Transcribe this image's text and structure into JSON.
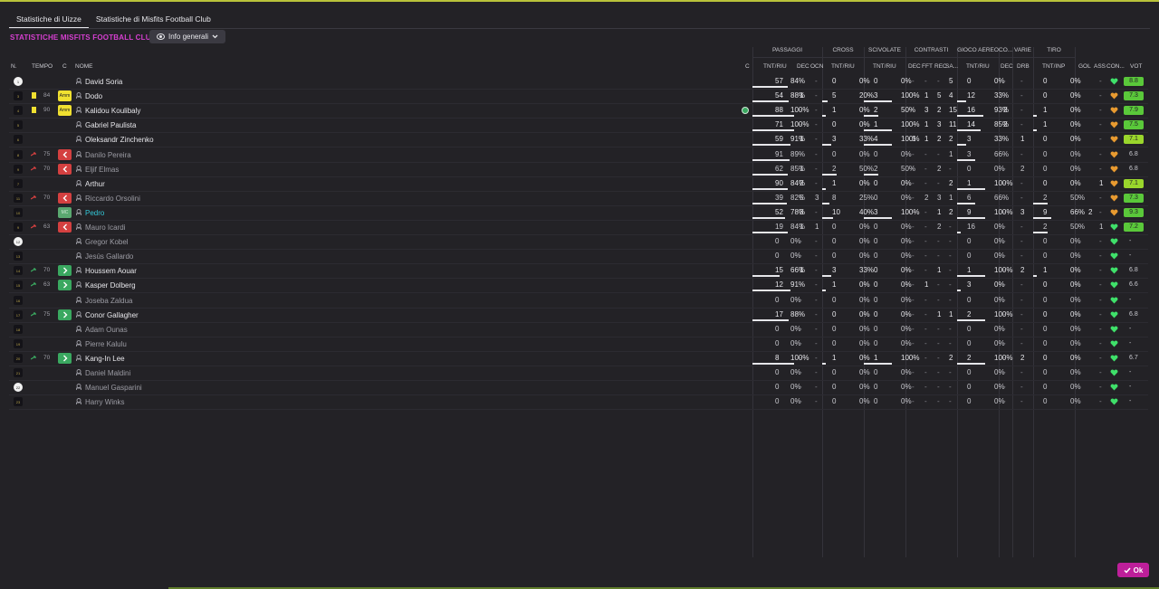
{
  "tabs": [
    "Statistiche di Uizze",
    "Statistiche di Misfits Football Club"
  ],
  "section_title": "STATISTICHE MISFITS FOOTBALL CLUB",
  "dropdown_label": "Info generali",
  "groups": [
    "PASSAGGI",
    "CROSS",
    "SCIVOLATE",
    "CONTRASTI",
    "GIOCO AEREO",
    "CO...",
    "VARIE",
    "TIRO"
  ],
  "col_left": [
    "N.",
    "TEMPO",
    "C",
    "NOME",
    "C"
  ],
  "col_stats": [
    "TNT/RIU",
    "DEC",
    "OCN",
    "TNT/RIU",
    "TNT/RIU",
    "DEC",
    "FFT",
    "REC",
    "SA...",
    "TNT/RIU",
    "DEC",
    "DRB",
    "TNT/INP",
    "GOL",
    "ASS",
    "CON...",
    "VOT"
  ],
  "ok_label": "Ok",
  "colors": {
    "accent": "#d63fd0",
    "ok": "#bd1f9a",
    "vote_green": "#5ac83a",
    "vote_lime": "#9ad62c",
    "heart_green": "#3fe06a",
    "heart_orange": "#e89a30",
    "sub_out": "#d44040",
    "sub_in": "#3aa860",
    "yellow": "#f0e030",
    "cyan": "#33c8d8"
  },
  "players": [
    {
      "num": "1",
      "gk": true,
      "min": "",
      "card": "",
      "role": "",
      "name": "David Soria",
      "dim": false,
      "pt": "57",
      "pp": "84%",
      "pd": "-",
      "po": "-",
      "ct": "0",
      "cp": "0%",
      "st": "0",
      "sp": "0%",
      "kd": "-",
      "kf": "-",
      "kr": "-",
      "ks": "5",
      "at": "0",
      "ap": "0%",
      "cd": "-",
      "dr": "-",
      "tt": "0",
      "tp": "0%",
      "gol": "",
      "ass": "-",
      "con": "green",
      "vot": "8.8",
      "vc": "green"
    },
    {
      "num": "3",
      "gk": false,
      "min": "84",
      "card": "y",
      "role": "Amm",
      "name": "Dodo",
      "dim": false,
      "pt": "54",
      "pp": "88%",
      "pd": "1",
      "po": "-",
      "ct": "5",
      "cp": "20%",
      "st": "3",
      "sp": "100%",
      "kd": "-",
      "kf": "1",
      "kr": "5",
      "ks": "4",
      "at": "12",
      "ap": "33%",
      "cd": "-",
      "dr": "-",
      "tt": "0",
      "tp": "0%",
      "gol": "",
      "ass": "-",
      "con": "orange",
      "vot": "7.3",
      "vc": "green"
    },
    {
      "num": "4",
      "gk": false,
      "min": "90",
      "card": "y",
      "role": "Amm",
      "name": "Kalidou Koulibaly",
      "dim": false,
      "cbadge": true,
      "pt": "88",
      "pp": "100%",
      "pd": "-",
      "po": "-",
      "ct": "1",
      "cp": "0%",
      "st": "2",
      "sp": "50%",
      "kd": "-",
      "kf": "3",
      "kr": "2",
      "ks": "15",
      "at": "16",
      "ap": "93%",
      "cd": "2",
      "dr": "-",
      "tt": "1",
      "tp": "0%",
      "gol": "",
      "ass": "-",
      "con": "orange",
      "vot": "7.9",
      "vc": "green"
    },
    {
      "num": "5",
      "gk": false,
      "min": "",
      "card": "",
      "role": "",
      "name": "Gabriel Paulista",
      "dim": false,
      "pt": "71",
      "pp": "100%",
      "pd": "-",
      "po": "-",
      "ct": "0",
      "cp": "0%",
      "st": "1",
      "sp": "100%",
      "kd": "-",
      "kf": "1",
      "kr": "3",
      "ks": "11",
      "at": "14",
      "ap": "85%",
      "cd": "2",
      "dr": "-",
      "tt": "1",
      "tp": "0%",
      "gol": "",
      "ass": "-",
      "con": "orange",
      "vot": "7.5",
      "vc": "green"
    },
    {
      "num": "6",
      "gk": false,
      "min": "",
      "card": "",
      "role": "",
      "name": "Oleksandr Zinchenko",
      "dim": false,
      "pt": "59",
      "pp": "91%",
      "pd": "1",
      "po": "-",
      "ct": "3",
      "cp": "33%",
      "st": "4",
      "sp": "100%",
      "kd": "1",
      "kf": "1",
      "kr": "2",
      "ks": "2",
      "at": "3",
      "ap": "33%",
      "cd": "-",
      "dr": "1",
      "tt": "0",
      "tp": "0%",
      "gol": "",
      "ass": "-",
      "con": "orange",
      "vot": "7.1",
      "vc": "lime"
    },
    {
      "num": "8",
      "gk": false,
      "min": "75",
      "card": "",
      "sub": "out",
      "role": "",
      "name": "Danilo Pereira",
      "dim": true,
      "pt": "91",
      "pp": "89%",
      "pd": "-",
      "po": "-",
      "ct": "0",
      "cp": "0%",
      "st": "0",
      "sp": "0%",
      "kd": "-",
      "kf": "-",
      "kr": "-",
      "ks": "1",
      "at": "3",
      "ap": "66%",
      "cd": "-",
      "dr": "-",
      "tt": "0",
      "tp": "0%",
      "gol": "",
      "ass": "-",
      "con": "orange",
      "vot": "6.8",
      "vc": "plain"
    },
    {
      "num": "9",
      "gk": false,
      "min": "70",
      "card": "",
      "sub": "out",
      "role": "",
      "name": "Eljif Elmas",
      "dim": true,
      "pt": "62",
      "pp": "85%",
      "pd": "1",
      "po": "-",
      "ct": "2",
      "cp": "50%",
      "st": "2",
      "sp": "50%",
      "kd": "-",
      "kf": "-",
      "kr": "2",
      "ks": "-",
      "at": "0",
      "ap": "0%",
      "cd": "-",
      "dr": "2",
      "tt": "0",
      "tp": "0%",
      "gol": "",
      "ass": "-",
      "con": "orange",
      "vot": "6.8",
      "vc": "plain"
    },
    {
      "num": "7",
      "gk": false,
      "min": "",
      "card": "",
      "role": "",
      "name": "Arthur",
      "dim": false,
      "pt": "90",
      "pp": "84%",
      "pd": "2",
      "po": "-",
      "ct": "1",
      "cp": "0%",
      "st": "0",
      "sp": "0%",
      "kd": "-",
      "kf": "-",
      "kr": "-",
      "ks": "2",
      "at": "1",
      "ap": "100%",
      "cd": "-",
      "dr": "-",
      "tt": "0",
      "tp": "0%",
      "gol": "",
      "ass": "1",
      "con": "orange",
      "vot": "7.1",
      "vc": "lime"
    },
    {
      "num": "11",
      "gk": false,
      "min": "70",
      "card": "",
      "sub": "out",
      "role": "",
      "name": "Riccardo Orsolini",
      "dim": true,
      "pt": "39",
      "pp": "82%",
      "pd": "5",
      "po": "3",
      "ct": "8",
      "cp": "25%",
      "st": "0",
      "sp": "0%",
      "kd": "-",
      "kf": "2",
      "kr": "3",
      "ks": "1",
      "at": "6",
      "ap": "66%",
      "cd": "-",
      "dr": "-",
      "tt": "2",
      "tp": "50%",
      "gol": "",
      "ass": "-",
      "con": "orange",
      "vot": "7.3",
      "vc": "green"
    },
    {
      "num": "10",
      "gk": false,
      "min": "",
      "card": "",
      "sub": "mc",
      "role": "MC",
      "name": "Pedro",
      "dim": false,
      "cyan": true,
      "pt": "52",
      "pp": "78%",
      "pd": "3",
      "po": "-",
      "ct": "10",
      "cp": "40%",
      "st": "3",
      "sp": "100%",
      "kd": "-",
      "kf": "-",
      "kr": "1",
      "ks": "2",
      "at": "9",
      "ap": "100%",
      "cd": "-",
      "dr": "3",
      "tt": "9",
      "tp": "66%",
      "gol": "2",
      "ass": "-",
      "con": "orange",
      "vot": "9.3",
      "vc": "green"
    },
    {
      "num": "9",
      "gk": false,
      "min": "63",
      "card": "",
      "sub": "out",
      "role": "",
      "name": "Mauro Icardi",
      "dim": true,
      "pt": "19",
      "pp": "84%",
      "pd": "1",
      "po": "1",
      "ct": "0",
      "cp": "0%",
      "st": "0",
      "sp": "0%",
      "kd": "-",
      "kf": "-",
      "kr": "2",
      "ks": "-",
      "at": "16",
      "ap": "0%",
      "cd": "-",
      "dr": "-",
      "tt": "2",
      "tp": "50%",
      "gol": "",
      "ass": "1",
      "con": "green",
      "vot": "7.2",
      "vc": "green"
    },
    {
      "num": "12",
      "gk": true,
      "min": "",
      "card": "",
      "role": "",
      "name": "Gregor Kobel",
      "dim": true,
      "pt": "0",
      "pp": "0%",
      "pd": "-",
      "po": "-",
      "ct": "0",
      "cp": "0%",
      "st": "0",
      "sp": "0%",
      "kd": "-",
      "kf": "-",
      "kr": "-",
      "ks": "-",
      "at": "0",
      "ap": "0%",
      "cd": "-",
      "dr": "-",
      "tt": "0",
      "tp": "0%",
      "gol": "",
      "ass": "-",
      "con": "green",
      "vot": "-",
      "vc": "plain"
    },
    {
      "num": "13",
      "gk": false,
      "min": "",
      "card": "",
      "role": "",
      "name": "Jesús Gallardo",
      "dim": true,
      "pt": "0",
      "pp": "0%",
      "pd": "-",
      "po": "-",
      "ct": "0",
      "cp": "0%",
      "st": "0",
      "sp": "0%",
      "kd": "-",
      "kf": "-",
      "kr": "-",
      "ks": "-",
      "at": "0",
      "ap": "0%",
      "cd": "-",
      "dr": "-",
      "tt": "0",
      "tp": "0%",
      "gol": "",
      "ass": "-",
      "con": "green",
      "vot": "-",
      "vc": "plain"
    },
    {
      "num": "14",
      "gk": false,
      "min": "70",
      "card": "",
      "sub": "in",
      "role": "",
      "name": "Houssem Aouar",
      "dim": false,
      "pt": "15",
      "pp": "66%",
      "pd": "1",
      "po": "-",
      "ct": "3",
      "cp": "33%",
      "st": "0",
      "sp": "0%",
      "kd": "-",
      "kf": "-",
      "kr": "1",
      "ks": "-",
      "at": "1",
      "ap": "100%",
      "cd": "-",
      "dr": "2",
      "tt": "1",
      "tp": "0%",
      "gol": "",
      "ass": "-",
      "con": "green",
      "vot": "6.8",
      "vc": "plain"
    },
    {
      "num": "15",
      "gk": false,
      "min": "63",
      "card": "",
      "sub": "in",
      "role": "",
      "name": "Kasper Dolberg",
      "dim": false,
      "pt": "12",
      "pp": "91%",
      "pd": "-",
      "po": "-",
      "ct": "1",
      "cp": "0%",
      "st": "0",
      "sp": "0%",
      "kd": "-",
      "kf": "1",
      "kr": "-",
      "ks": "-",
      "at": "3",
      "ap": "0%",
      "cd": "-",
      "dr": "-",
      "tt": "0",
      "tp": "0%",
      "gol": "",
      "ass": "-",
      "con": "green",
      "vot": "6.6",
      "vc": "plain"
    },
    {
      "num": "16",
      "gk": false,
      "min": "",
      "card": "",
      "role": "",
      "name": "Joseba Zaldua",
      "dim": true,
      "pt": "0",
      "pp": "0%",
      "pd": "-",
      "po": "-",
      "ct": "0",
      "cp": "0%",
      "st": "0",
      "sp": "0%",
      "kd": "-",
      "kf": "-",
      "kr": "-",
      "ks": "-",
      "at": "0",
      "ap": "0%",
      "cd": "-",
      "dr": "-",
      "tt": "0",
      "tp": "0%",
      "gol": "",
      "ass": "-",
      "con": "green",
      "vot": "-",
      "vc": "plain"
    },
    {
      "num": "17",
      "gk": false,
      "min": "75",
      "card": "",
      "sub": "in",
      "role": "",
      "name": "Conor Gallagher",
      "dim": false,
      "pt": "17",
      "pp": "88%",
      "pd": "-",
      "po": "-",
      "ct": "0",
      "cp": "0%",
      "st": "0",
      "sp": "0%",
      "kd": "-",
      "kf": "-",
      "kr": "1",
      "ks": "1",
      "at": "2",
      "ap": "100%",
      "cd": "-",
      "dr": "-",
      "tt": "0",
      "tp": "0%",
      "gol": "",
      "ass": "-",
      "con": "green",
      "vot": "6.8",
      "vc": "plain"
    },
    {
      "num": "18",
      "gk": false,
      "min": "",
      "card": "",
      "role": "",
      "name": "Adam Ounas",
      "dim": true,
      "pt": "0",
      "pp": "0%",
      "pd": "-",
      "po": "-",
      "ct": "0",
      "cp": "0%",
      "st": "0",
      "sp": "0%",
      "kd": "-",
      "kf": "-",
      "kr": "-",
      "ks": "-",
      "at": "0",
      "ap": "0%",
      "cd": "-",
      "dr": "-",
      "tt": "0",
      "tp": "0%",
      "gol": "",
      "ass": "-",
      "con": "green",
      "vot": "-",
      "vc": "plain"
    },
    {
      "num": "19",
      "gk": false,
      "min": "",
      "card": "",
      "role": "",
      "name": "Pierre Kalulu",
      "dim": true,
      "pt": "0",
      "pp": "0%",
      "pd": "-",
      "po": "-",
      "ct": "0",
      "cp": "0%",
      "st": "0",
      "sp": "0%",
      "kd": "-",
      "kf": "-",
      "kr": "-",
      "ks": "-",
      "at": "0",
      "ap": "0%",
      "cd": "-",
      "dr": "-",
      "tt": "0",
      "tp": "0%",
      "gol": "",
      "ass": "-",
      "con": "green",
      "vot": "-",
      "vc": "plain"
    },
    {
      "num": "20",
      "gk": false,
      "min": "70",
      "card": "",
      "sub": "in",
      "role": "",
      "name": "Kang-In Lee",
      "dim": false,
      "pt": "8",
      "pp": "100%",
      "pd": "-",
      "po": "-",
      "ct": "1",
      "cp": "0%",
      "st": "1",
      "sp": "100%",
      "kd": "-",
      "kf": "-",
      "kr": "-",
      "ks": "2",
      "at": "2",
      "ap": "100%",
      "cd": "-",
      "dr": "2",
      "tt": "0",
      "tp": "0%",
      "gol": "",
      "ass": "-",
      "con": "green",
      "vot": "6.7",
      "vc": "plain"
    },
    {
      "num": "21",
      "gk": false,
      "min": "",
      "card": "",
      "role": "",
      "name": "Daniel Maldini",
      "dim": true,
      "pt": "0",
      "pp": "0%",
      "pd": "-",
      "po": "-",
      "ct": "0",
      "cp": "0%",
      "st": "0",
      "sp": "0%",
      "kd": "-",
      "kf": "-",
      "kr": "-",
      "ks": "-",
      "at": "0",
      "ap": "0%",
      "cd": "-",
      "dr": "-",
      "tt": "0",
      "tp": "0%",
      "gol": "",
      "ass": "-",
      "con": "green",
      "vot": "-",
      "vc": "plain"
    },
    {
      "num": "22",
      "gk": true,
      "min": "",
      "card": "",
      "role": "",
      "name": "Manuel Gasparini",
      "dim": true,
      "pt": "0",
      "pp": "0%",
      "pd": "-",
      "po": "-",
      "ct": "0",
      "cp": "0%",
      "st": "0",
      "sp": "0%",
      "kd": "-",
      "kf": "-",
      "kr": "-",
      "ks": "-",
      "at": "0",
      "ap": "0%",
      "cd": "-",
      "dr": "-",
      "tt": "0",
      "tp": "0%",
      "gol": "",
      "ass": "-",
      "con": "green",
      "vot": "-",
      "vc": "plain"
    },
    {
      "num": "23",
      "gk": false,
      "min": "",
      "card": "",
      "role": "",
      "name": "Harry Winks",
      "dim": true,
      "pt": "0",
      "pp": "0%",
      "pd": "-",
      "po": "-",
      "ct": "0",
      "cp": "0%",
      "st": "0",
      "sp": "0%",
      "kd": "-",
      "kf": "-",
      "kr": "-",
      "ks": "-",
      "at": "0",
      "ap": "0%",
      "cd": "-",
      "dr": "-",
      "tt": "0",
      "tp": "0%",
      "gol": "",
      "ass": "-",
      "con": "green",
      "vot": "-",
      "vc": "plain"
    }
  ]
}
